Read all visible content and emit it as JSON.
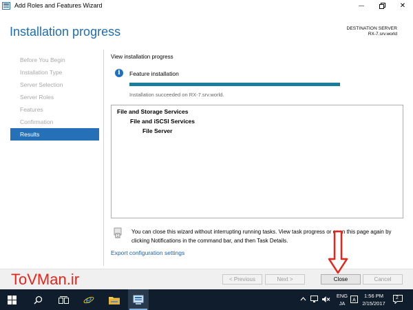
{
  "window": {
    "title": "Add Roles and Features Wizard",
    "minimize_glyph": "—",
    "close_glyph": "✕"
  },
  "header": {
    "page_title": "Installation progress",
    "destination_label": "DESTINATION SERVER",
    "destination_server": "RX-7.srv.world"
  },
  "nav": {
    "items": [
      {
        "label": "Before You Begin",
        "active": false
      },
      {
        "label": "Installation Type",
        "active": false
      },
      {
        "label": "Server Selection",
        "active": false
      },
      {
        "label": "Server Roles",
        "active": false
      },
      {
        "label": "Features",
        "active": false
      },
      {
        "label": "Confirmation",
        "active": false
      },
      {
        "label": "Results",
        "active": true
      }
    ]
  },
  "main": {
    "view_progress_label": "View installation progress",
    "info_glyph": "i",
    "feature_label": "Feature installation",
    "progress_fraction": 1.0,
    "status_text": "Installation succeeded on RX-7.srv.world.",
    "results": [
      {
        "text": "File and Storage Services",
        "level": 0
      },
      {
        "text": "File and iSCSI Services",
        "level": 1
      },
      {
        "text": "File Server",
        "level": 2
      }
    ],
    "note_text": "You can close this wizard without interrupting running tasks. View task progress or open this page again by clicking Notifications in the command bar, and then Task Details.",
    "export_link": "Export configuration settings"
  },
  "footer": {
    "previous_label": "< Previous",
    "next_label": "Next >",
    "close_label": "Close",
    "cancel_label": "Cancel"
  },
  "overlay": {
    "watermark": "ToVMan.ir"
  },
  "taskbar": {
    "ime_lang": "ENG",
    "ime_mode": "JA",
    "time": "1:56 PM",
    "date": "2/15/2017",
    "notification_count": "2"
  },
  "colors": {
    "accent": "#1e6eb0",
    "nav_active": "#2670b8",
    "progress": "#1a7d9c",
    "watermark": "#e8241a",
    "taskbar": "#101d2c"
  }
}
